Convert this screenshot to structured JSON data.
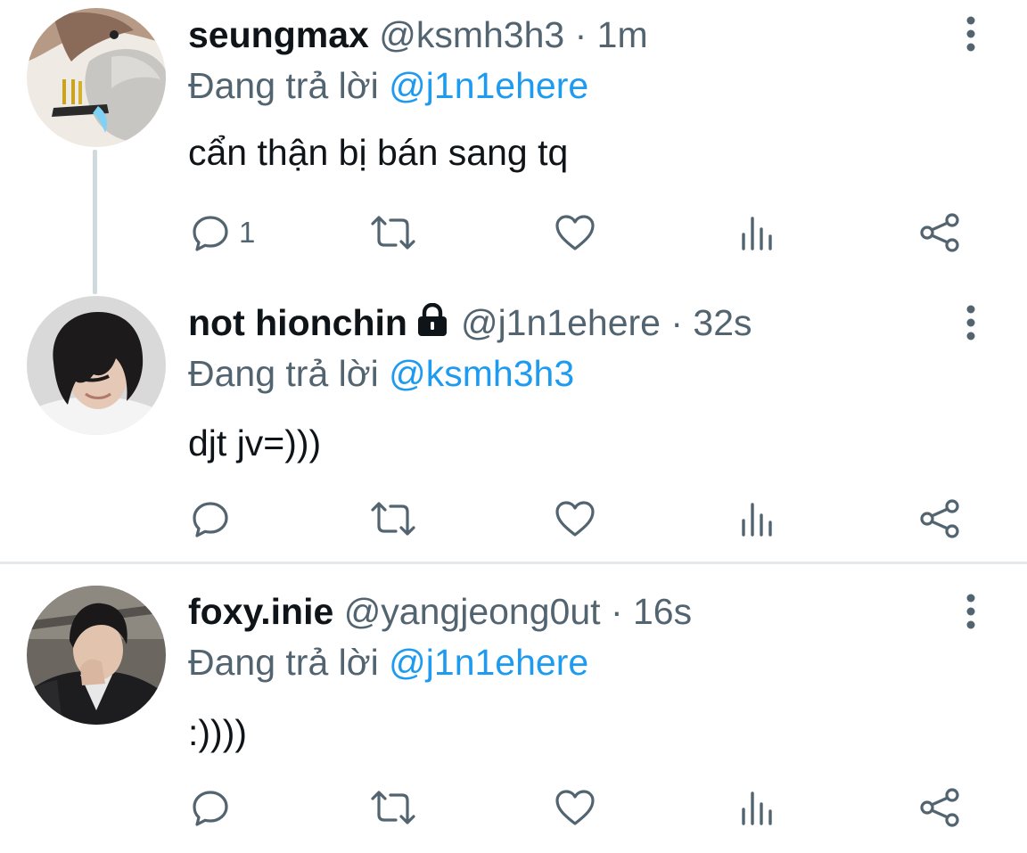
{
  "tweets": [
    {
      "display_name": "seungmax",
      "handle": "@ksmh3h3",
      "separator": "·",
      "time": "1m",
      "locked": false,
      "reply_prefix": "Đang trả lời",
      "reply_to": "@j1n1ehere",
      "text": "cẩn thận bị bán sang tq",
      "reply_count": "1",
      "avatar": "photo-person-hood"
    },
    {
      "display_name": "not hionchin",
      "handle": "@j1n1ehere",
      "separator": "·",
      "time": "32s",
      "locked": true,
      "reply_prefix": "Đang trả lời",
      "reply_to": "@ksmh3h3",
      "text": "djt jv=)))",
      "reply_count": "",
      "avatar": "photo-person-dark-hair"
    },
    {
      "display_name": "foxy.inie",
      "handle": "@yangjeong0ut",
      "separator": "·",
      "time": "16s",
      "locked": false,
      "reply_prefix": "Đang trả lời",
      "reply_to": "@j1n1ehere",
      "text": ":))))",
      "reply_count": "",
      "avatar": "photo-person-jacket"
    }
  ],
  "actions": [
    "reply-icon",
    "retweet-icon",
    "like-icon",
    "views-icon",
    "share-icon"
  ],
  "more_icon": "more-vertical-icon",
  "lock_icon": "lock-icon",
  "colors": {
    "text": "#0f1419",
    "secondary": "#536471",
    "mention": "#1d9bf0",
    "icon": "#536471",
    "divider": "#e6e9ec",
    "thread_line": "#cfd9de"
  }
}
